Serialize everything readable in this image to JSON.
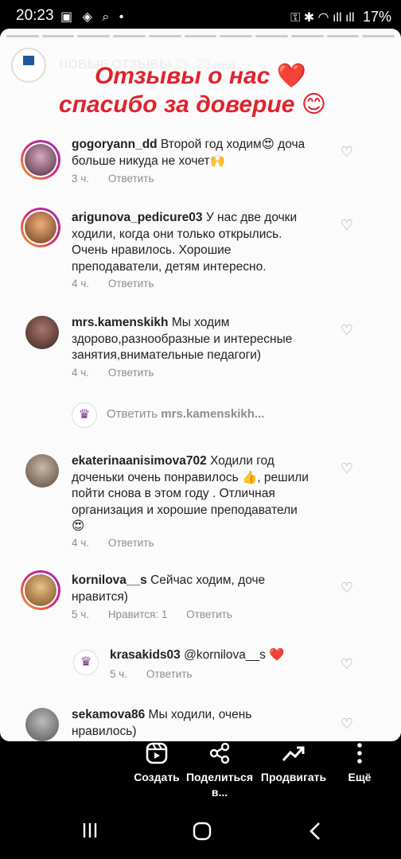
{
  "status_bar": {
    "time": "20:23",
    "left_icons": "▣ ◈ ⌕ •",
    "right_icons": "⚿ ✱ ◠ ıll ıll",
    "battery": "17%"
  },
  "story": {
    "account_name": "НОВЫЕ ОТЗЫВЫ 😊",
    "time_ago": "23 нед.",
    "headline_1": "Отзывы о нас",
    "headline_1_emoji": "❤️",
    "headline_2": "спасибо за доверие",
    "headline_2_emoji": "😊"
  },
  "comments": [
    {
      "username": "gogoryann_dd",
      "text": "Второй год ходим😍 доча больше никуда не хочет🙌",
      "time": "3 ч.",
      "reply_label": "Ответить"
    },
    {
      "username": "arigunova_pedicure03",
      "text": "У нас две дочки ходили, когда они только открылись. Очень нравилось. Хорошие преподаватели, детям интересно.",
      "time": "4 ч.",
      "reply_label": "Ответить"
    },
    {
      "username": "mrs.kamenskikh",
      "text": "Мы ходим здорово,разнообразные и интересные занятия,внимательные педагоги)",
      "time": "4 ч.",
      "reply_label": "Ответить"
    },
    {
      "username": "ekaterinaanisimova702",
      "text": "Ходили год доченьки  очень понравилось 👍, решили пойти снова в этом году . Отличная организация и хорошие преподаватели 😍",
      "time": "4 ч.",
      "reply_label": "Ответить"
    },
    {
      "username": "kornilova__s",
      "text": "Сейчас ходим, доче нравится)",
      "time": "5 ч.",
      "likes": "Нравится: 1",
      "reply_label": "Ответить"
    },
    {
      "username": "sekamova86",
      "text": "Мы ходили, очень нравилось)"
    }
  ],
  "reply_prompt": {
    "label": "Ответить",
    "target": "mrs.kamenskikh..."
  },
  "reply": {
    "username": "krasakids03",
    "text": "@kornilova__s ❤️",
    "time": "5 ч.",
    "reply_label": "Ответить"
  },
  "actions": [
    {
      "label": "Создать",
      "icon": "reels-icon"
    },
    {
      "label": "Поделиться в...",
      "icon": "share-icon"
    },
    {
      "label": "Продвигать",
      "icon": "trending-icon"
    },
    {
      "label": "Ещё",
      "icon": "more-vertical-icon"
    }
  ],
  "colors": {
    "headline": "#e0232e",
    "meta_gray": "#8e8e8e",
    "ring_gradient": [
      "#f5a623",
      "#d62976",
      "#962fbf"
    ]
  }
}
